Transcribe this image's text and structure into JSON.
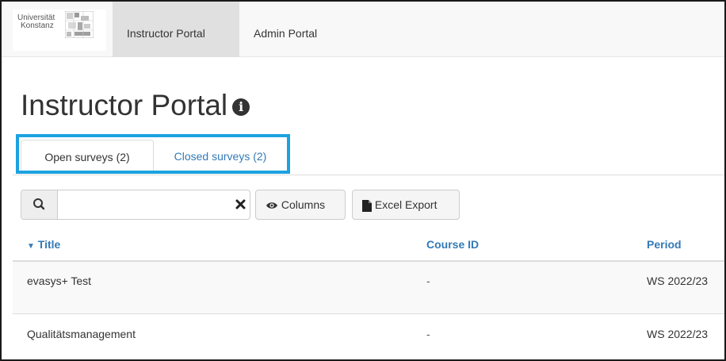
{
  "logo": {
    "line1": "Universität",
    "line2": "Konstanz"
  },
  "nav": {
    "items": [
      {
        "label": "Instructor Portal",
        "active": true
      },
      {
        "label": "Admin Portal",
        "active": false
      }
    ]
  },
  "page": {
    "title": "Instructor Portal",
    "info_icon": "info-circle-icon"
  },
  "tabs": [
    {
      "label": "Open surveys (2)",
      "active": true
    },
    {
      "label": "Closed surveys (2)",
      "active": false
    }
  ],
  "toolbar": {
    "search_icon": "search-icon",
    "search_value": "",
    "clear_icon": "close-icon",
    "columns_label": "Columns",
    "export_label": "Excel Export"
  },
  "table": {
    "sort_indicator": "▼",
    "headers": {
      "title": "Title",
      "course_id": "Course ID",
      "period": "Period"
    },
    "rows": [
      {
        "title": "evasys+ Test",
        "course_id": "-",
        "period": "WS 2022/23"
      },
      {
        "title": "Qualitätsmanagement",
        "course_id": "-",
        "period": "WS 2022/23"
      }
    ]
  },
  "colors": {
    "highlight": "#1ca2e0",
    "link": "#337ab7",
    "nav_bg": "#f8f8f8",
    "nav_active": "#e0e0e0"
  }
}
